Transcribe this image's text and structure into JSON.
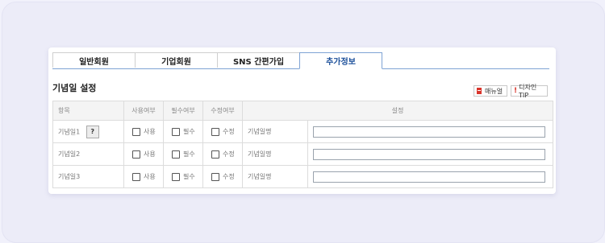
{
  "tabs": [
    {
      "label": "일반회원",
      "active": false
    },
    {
      "label": "기업회원",
      "active": false
    },
    {
      "label": "SNS 간편가입",
      "active": false
    },
    {
      "label": "추가정보",
      "active": true
    }
  ],
  "section_title": "기념일 설정",
  "buttons": {
    "manual": "매뉴얼",
    "design_tip": "디자인TIP"
  },
  "table": {
    "headers": {
      "item": "항목",
      "use": "사용여부",
      "required": "필수여부",
      "edit": "수정여부",
      "setting": "설정"
    },
    "rows": [
      {
        "item": "기념일1",
        "use": "사용",
        "required": "필수",
        "edit": "수정",
        "name_label": "기념일명",
        "value": ""
      },
      {
        "item": "기념일2",
        "use": "사용",
        "required": "필수",
        "edit": "수정",
        "name_label": "기념일명",
        "value": ""
      },
      {
        "item": "기념일3",
        "use": "사용",
        "required": "필수",
        "edit": "수정",
        "name_label": "기념일명",
        "value": ""
      }
    ],
    "help": "?"
  },
  "colors": {
    "active_tab_border": "#7fa3d4",
    "accent_red": "#d9342b"
  }
}
